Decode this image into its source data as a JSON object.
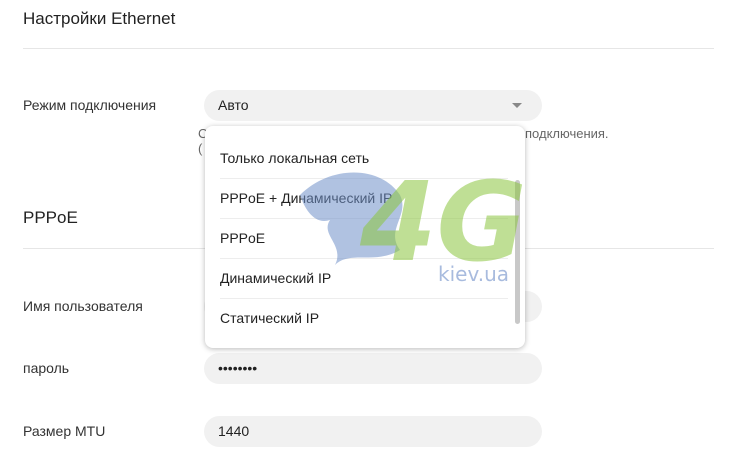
{
  "ethernet": {
    "title": "Настройки Ethernet",
    "mode_label": "Режим подключения",
    "mode_value": "Авто",
    "hint_left_1": "С",
    "hint_left_2": "(",
    "hint_right": "подключения."
  },
  "dropdown": {
    "options": [
      "Только локальная сеть",
      "PPPoE + Динамический IP",
      "PPPoE",
      "Динамический IP",
      "Статический IP"
    ]
  },
  "pppoe": {
    "title": "PPPoE",
    "username_label": "Имя пользователя",
    "password_label": "пароль",
    "password_value": "••••••••",
    "mtu_label": "Размер MTU",
    "mtu_value": "1440"
  },
  "watermark": {
    "logo_text": "4G",
    "site_text": "kiev.ua",
    "colors": {
      "green": "#8cc63f",
      "blue": "#6f8fc9"
    }
  }
}
